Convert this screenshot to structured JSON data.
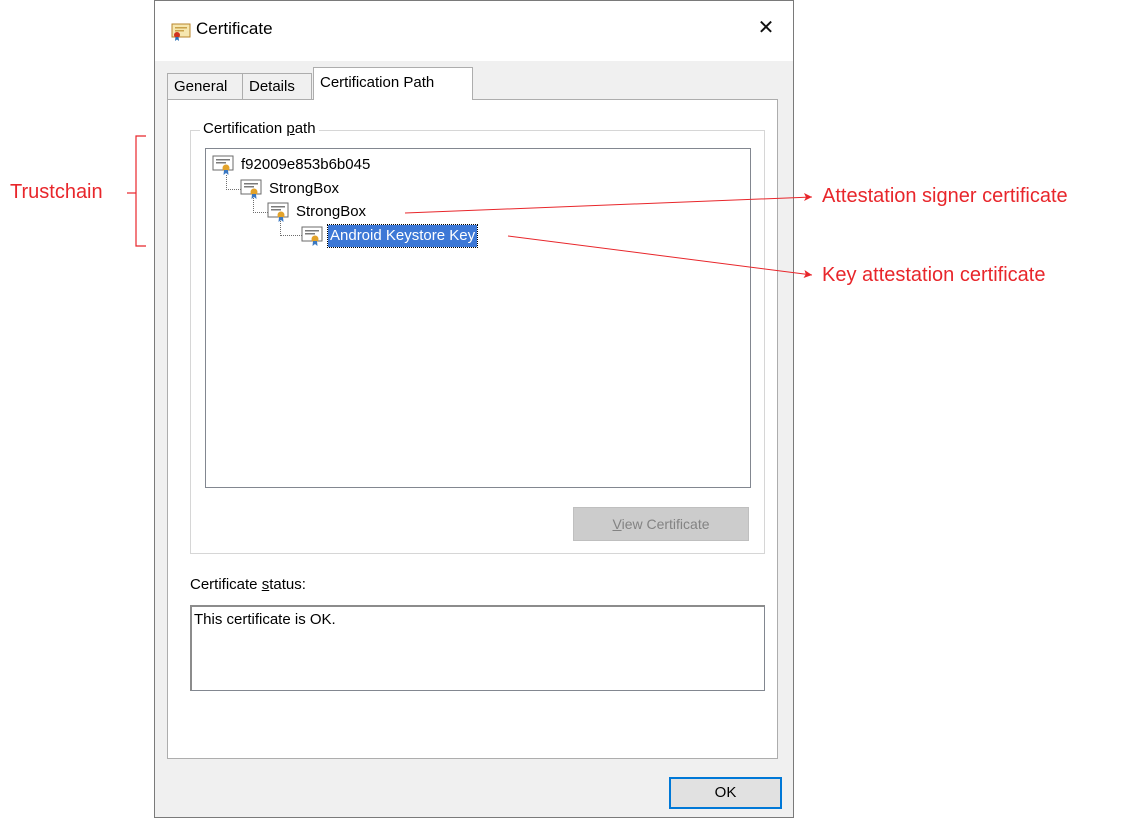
{
  "window": {
    "title": "Certificate",
    "close_glyph": "✕"
  },
  "tabs": [
    {
      "label": "General"
    },
    {
      "label": "Details"
    },
    {
      "label": "Certification Path",
      "active": true
    }
  ],
  "path_group": {
    "legend_prefix": "Certification ",
    "legend_underlined": "p",
    "legend_suffix": "ath",
    "tree": [
      {
        "label": "f92009e853b6b045",
        "level": 0,
        "icon": "certificate-icon"
      },
      {
        "label": "StrongBox",
        "level": 1,
        "icon": "certificate-icon"
      },
      {
        "label": "StrongBox",
        "level": 2,
        "icon": "certificate-icon"
      },
      {
        "label": "Android Keystore Key",
        "level": 3,
        "icon": "certificate-icon",
        "selected": true
      }
    ],
    "view_button_underlined": "V",
    "view_button_rest": "iew Certificate"
  },
  "status": {
    "label_prefix": "Certificate ",
    "label_underlined": "s",
    "label_suffix": "tatus:",
    "text": "This certificate is OK."
  },
  "ok_label": "OK",
  "annotations": {
    "trustchain": "Trustchain",
    "signer": "Attestation signer certificate",
    "key": "Key attestation certificate",
    "color": "#e8262b"
  },
  "colors": {
    "selection": "#3d78d6",
    "focus_border": "#0078d7",
    "dialog_bg": "#f0f0f0"
  }
}
